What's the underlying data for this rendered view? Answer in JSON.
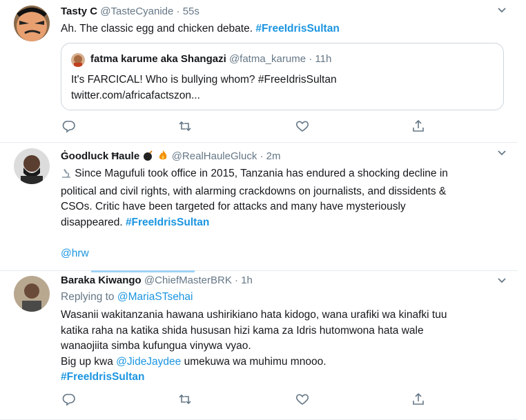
{
  "tweets": [
    {
      "name": "Tasty C",
      "handle": "@TasteCyanide",
      "time": "55s",
      "text": "Ah. The classic egg and chicken debate. ",
      "hashtag": "#FreeIdrisSultan",
      "quote": {
        "name": "fatma karume aka Shangazi",
        "handle": "@fatma_karume",
        "time": "11h",
        "line1": "It's FARCICAL! Who is bullying whom? #FreeIdrisSultan",
        "line2": "twitter.com/africafactszon..."
      }
    },
    {
      "name": "Ġoodluck Ħaule",
      "handle": "@RealHauleGluck",
      "time": "2m",
      "line1": " Since Magufuli took office in 2015, Tanzania has endured a shocking decline in",
      "line2": "political and civil rights, with alarming crackdowns on journalists, and dissidents &",
      "line3": "CSOs. Critic have been targeted for attacks and many have mysteriously",
      "line4": "disappeared. ",
      "hashtag": "#FreeIdrisSultan",
      "mention": "@hrw"
    },
    {
      "name": "Baraka Kiwango",
      "handle": "@ChiefMasterBRK",
      "time": "1h",
      "replying_label": "Replying to ",
      "replying_to": "@MariaSTsehai",
      "line1": "Wasanii wakitanzania hawana ushirikiano hata kidogo, wana urafiki wa kinafki tuu",
      "line2": "katika raha na katika shida hususan hizi kama za Idris hutomwona hata wale",
      "line3": "wanaojiita simba kufungua vinywa vyao.",
      "line4a": "Big up  kwa ",
      "line4_mention": "@JideJaydee",
      "line4b": " umekuwa wa muhimu mnooo.",
      "hashtag": "#FreeIdrisSultan"
    }
  ],
  "separator": "·",
  "icons": {
    "reply": "reply-icon",
    "retweet": "retweet-icon",
    "like": "heart-icon",
    "share": "share-icon",
    "caret": "chevron-down-icon"
  },
  "colors": {
    "link": "#1b95e0",
    "muted": "#657786",
    "border": "#e6ecf0"
  }
}
